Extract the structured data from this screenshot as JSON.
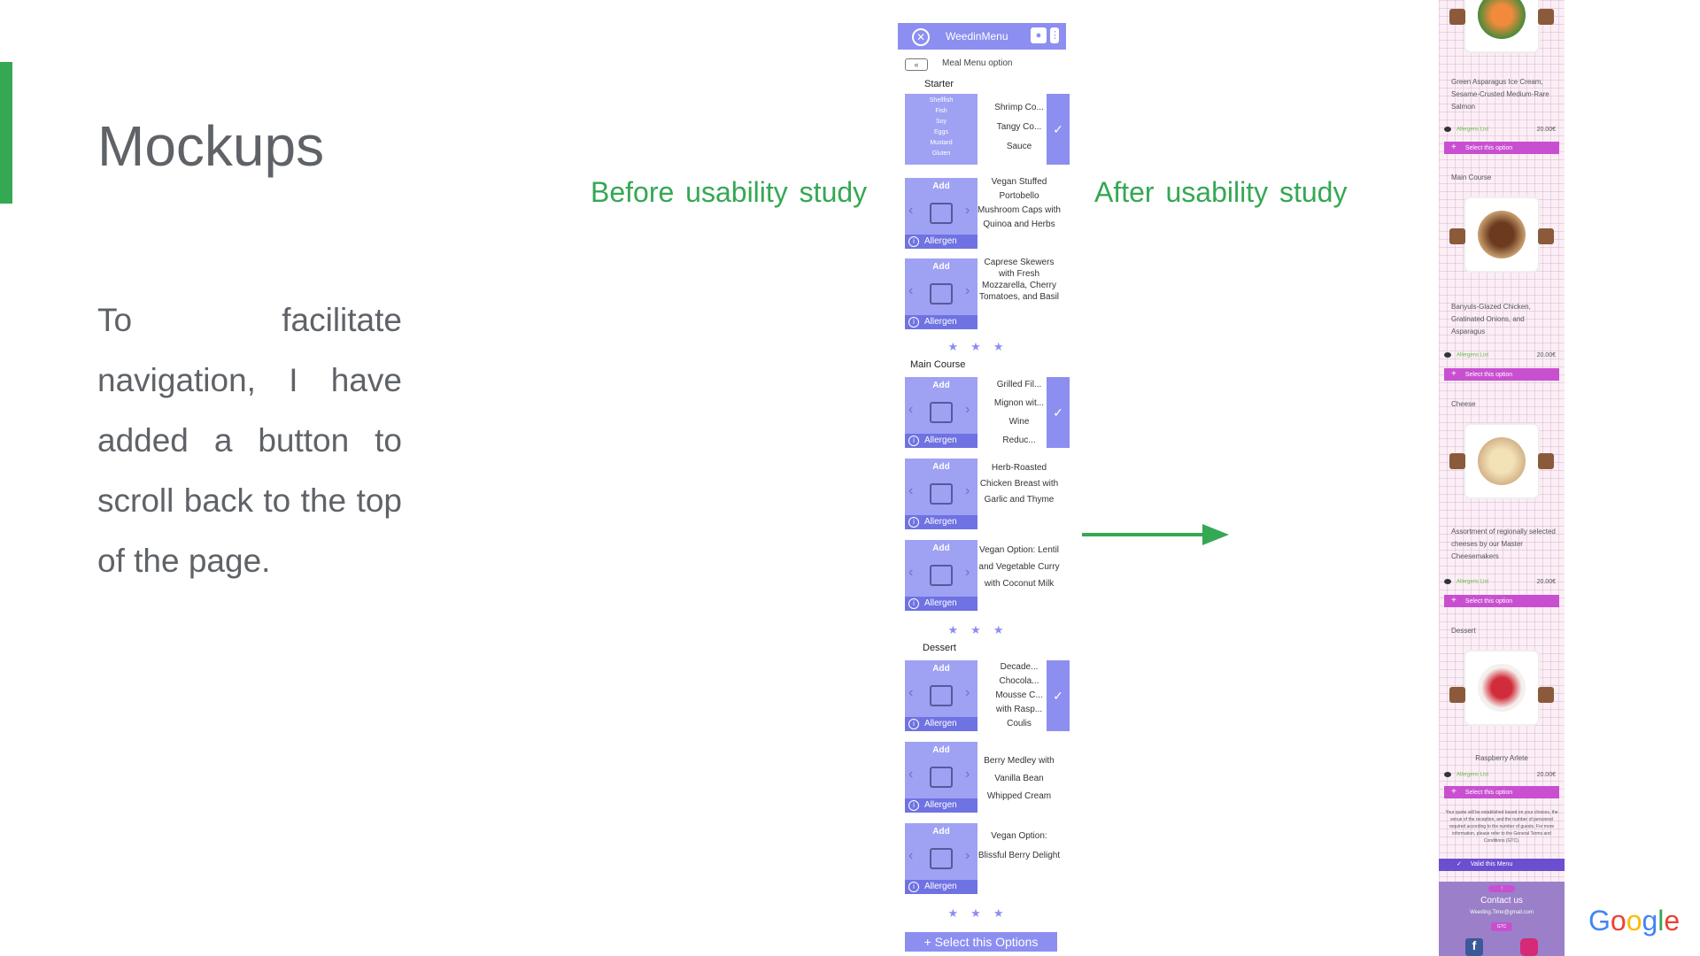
{
  "slide": {
    "title": "Mockups",
    "description": "To facilitate navigation, I have added a button to scroll back to the top of the page.",
    "before_label": "Before usability study",
    "after_label": "After usability study",
    "brand": [
      "G",
      "o",
      "o",
      "g",
      "l",
      "e"
    ],
    "brand_colors": [
      "#4285f4",
      "#ea4335",
      "#fbbc05",
      "#4285f4",
      "#34a853",
      "#ea4335"
    ],
    "accent_color": "#34a853"
  },
  "before": {
    "app_name": "WeedinMenu",
    "back_label": "«",
    "menu_option": "Meal Menu option",
    "sections": {
      "starter": "Starter",
      "main": "Main Course",
      "dessert": "Dessert"
    },
    "stars": "★★★",
    "add_label": "Add",
    "allergen_label": "Allergen",
    "allergen_list": [
      "Shellfish",
      "Fish",
      "Soy",
      "Eggs",
      "Mustard",
      "Gluten"
    ],
    "items": {
      "s1_lines": [
        "Shrimp Co...",
        "Tangy Co...",
        "Sauce"
      ],
      "s2": "Vegan Stuffed Portobello Mushroom Caps with Quinoa and Herbs",
      "s3": "Caprese Skewers with Fresh Mozzarella, Cherry Tomatoes, and Basil",
      "m1_lines": [
        "Grilled Fil...",
        "Mignon wit...",
        "Wine",
        "Reduc..."
      ],
      "m2": "Herb-Roasted Chicken Breast with Garlic and Thyme",
      "m3": "Vegan Option: Lentil and Vegetable Curry with Coconut Milk",
      "d1_lines": [
        "Decade...",
        "Chocola...",
        "Mousse C...",
        "with Rasp...",
        "Coulis"
      ],
      "d2": "Berry Medley with Vanilla Bean Whipped Cream",
      "d3": "Vegan Option: Blissful Berry Delight"
    },
    "select_button": "+ Select this Options"
  },
  "after": {
    "dish1": "Green Asparagus Ice Cream, Sesame-Crusted Medium-Rare Salmon",
    "section_main": "Main Course",
    "dish2": "Banyuls-Glazed Chicken, Gratinated Onions, and Asparagus",
    "section_cheese": "Cheese",
    "dish3": "Assortment of regionally selected cheeses by our Master Cheesemakers",
    "section_dessert": "Dessert",
    "dish4": "Raspberry Arlete",
    "allergen_list": "Allergens List",
    "price": "20.00€",
    "select_option": "Select this option",
    "terms": "Your quote will be established based on your choices, the venue of the reception, and the number of personnel required according to the number of guests. For more information, please refer to the General Terms and Conditions (GTC).",
    "valid_menu": "Valid this Menu",
    "contact": "Contact us",
    "email": "Weeding.Time@gmail.com",
    "cgv": "GTC"
  }
}
